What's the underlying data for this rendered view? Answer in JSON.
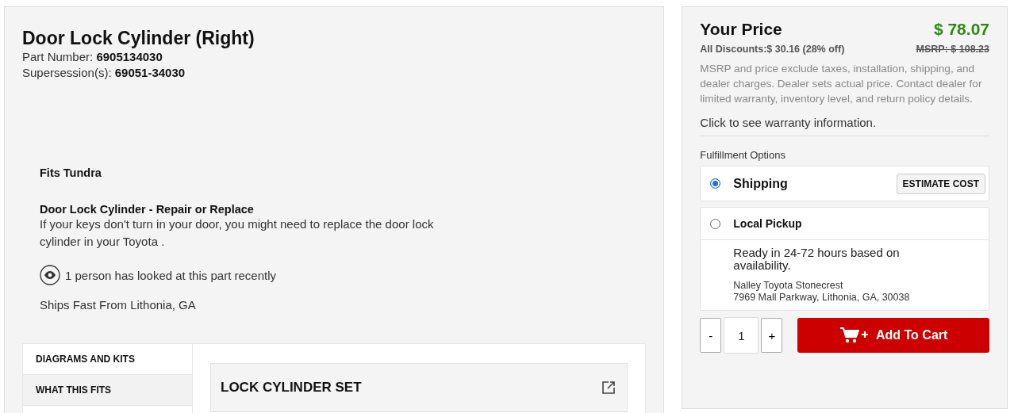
{
  "product": {
    "title": "Door Lock Cylinder (Right)",
    "part_number_label": "Part Number:",
    "part_number": "6905134030",
    "supersession_label": "Supersession(s):",
    "supersession": "69051-34030",
    "fits": "Fits Tundra",
    "heading": "Door Lock Cylinder - Repair or Replace",
    "description": "If your keys don't turn in your door, you might need to replace the door lock cylinder in your Toyota .",
    "views": "1 person has looked at this part recently",
    "ships": "Ships Fast From Lithonia, GA"
  },
  "tabs": [
    {
      "label": "DIAGRAMS AND KITS",
      "selected": true
    },
    {
      "label": "WHAT THIS FITS",
      "selected": false
    }
  ],
  "diagram_card": {
    "title": "LOCK CYLINDER SET"
  },
  "price": {
    "title": "Your Price",
    "amount": "$ 78.07",
    "discounts": "All Discounts:$ 30.16 (28% off)",
    "msrp": "MSRP: $ 108.23",
    "disclaimer": "MSRP and price exclude taxes, installation, shipping, and dealer charges. Dealer sets actual price. Contact dealer for limited warranty, inventory level, and return policy details.",
    "warranty_link": "Click to see warranty information."
  },
  "fulfillment": {
    "label": "Fulfillment Options",
    "options": [
      {
        "kind": "shipping",
        "label": "Shipping",
        "selected": true,
        "button": "ESTIMATE COST"
      },
      {
        "kind": "pickup",
        "label": "Local Pickup",
        "selected": false,
        "ready": "Ready in 24-72 hours based on availability.",
        "dealer": "Nalley Toyota Stonecrest",
        "address": "7969 Mall Parkway, Lithonia, GA, 30038"
      }
    ]
  },
  "cart": {
    "minus": "-",
    "quantity": "1",
    "plus": "+",
    "button": "Add To Cart"
  }
}
